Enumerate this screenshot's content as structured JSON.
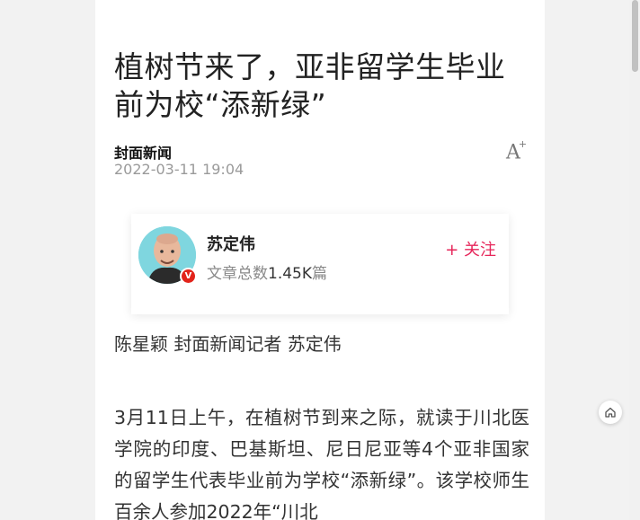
{
  "article": {
    "title": "植树节来了，亚非留学生毕业前为校“添新绿”",
    "source": "封面新闻",
    "datetime": "2022-03-11 19:04",
    "font_size_icon": "A",
    "font_size_plus": "+",
    "byline": "陈星颖 封面新闻记者 苏定伟",
    "body": "3月11日上午，在植树节到来之际，就读于川北医学院的印度、巴基斯坦、尼日尼亚等4个亚非国家的留学生代表毕业前为学校“添新绿”。该学校师生百余人参加2022年“川北"
  },
  "author": {
    "name": "苏定伟",
    "stats_label": "文章总数",
    "stats_value": "1.45K",
    "stats_unit": "篇",
    "follow_label": "+ 关注",
    "badge": "V",
    "badge_color": "#e2231a"
  },
  "colors": {
    "follow": "#e6265a",
    "avatar_bg": "#7fd6df"
  },
  "icons": {
    "font_size": "font-size-icon",
    "home": "home-icon",
    "verified": "verified-badge-icon"
  }
}
